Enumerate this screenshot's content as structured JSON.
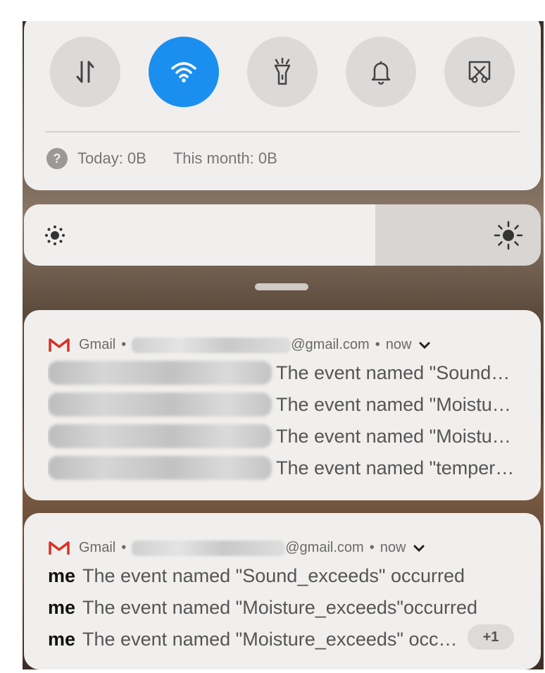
{
  "quick_settings": {
    "buttons": [
      {
        "name": "mobile-data",
        "active": false
      },
      {
        "name": "wifi",
        "active": true
      },
      {
        "name": "flashlight",
        "active": false
      },
      {
        "name": "sound",
        "active": false
      },
      {
        "name": "screenshot",
        "active": false
      }
    ],
    "usage_today": "Today: 0B",
    "usage_month": "This month: 0B"
  },
  "brightness": {
    "level": 0.68
  },
  "notifications": [
    {
      "app": "Gmail",
      "separator": "•",
      "account_suffix": "@gmail.com",
      "time": "now",
      "messages": [
        "The event named \"Sound_exceeds\"",
        "The event named \"Moisture_exceeds\"",
        "The event named \"Moisture_exceeds\"",
        "The event named \"temperature\""
      ]
    },
    {
      "app": "Gmail",
      "separator": "•",
      "account_suffix": "@gmail.com",
      "time": "now",
      "sender": "me",
      "messages": [
        "The event named \"Sound_exceeds\" occurred",
        "The event named \"Moisture_exceeds\"occurred",
        "The event named \"Moisture_exceeds\" occurred"
      ],
      "more_count": "+1"
    }
  ],
  "colors": {
    "accent": "#1a8ff0",
    "gmail_red": "#d93025"
  }
}
